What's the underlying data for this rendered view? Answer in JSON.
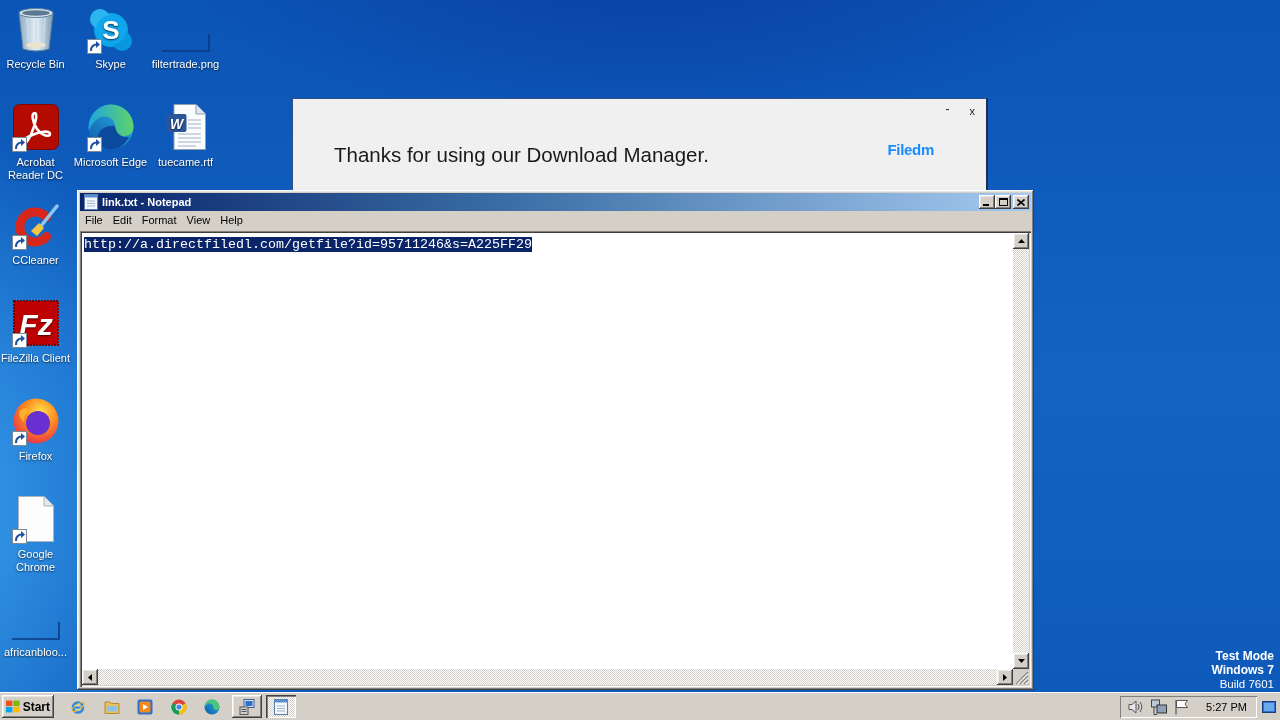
{
  "desktop": {
    "columns": [
      {
        "icons": [
          {
            "kind": "recycle-bin",
            "label": "Recycle Bin",
            "shortcut": false
          },
          {
            "kind": "pdf-reader",
            "label": "Acrobat Reader DC",
            "shortcut": true
          },
          {
            "kind": "ccleaner",
            "label": "CCleaner",
            "shortcut": true
          },
          {
            "kind": "filezilla",
            "glyph": "Fz",
            "label": "FileZilla Client",
            "shortcut": true
          },
          {
            "kind": "firefox",
            "label": "Firefox",
            "shortcut": true
          },
          {
            "kind": "blank-file",
            "label": "Google Chrome",
            "shortcut": true
          },
          {
            "kind": "thumbnail",
            "label": "africanbloo...",
            "shortcut": false
          }
        ]
      },
      {
        "icons": [
          {
            "kind": "skype",
            "glyph": "S",
            "label": "Skype",
            "shortcut": true
          },
          {
            "kind": "edge",
            "label": "Microsoft Edge",
            "shortcut": true
          }
        ]
      },
      {
        "icons": [
          {
            "kind": "thumbnail",
            "label": "filtertrade.png",
            "shortcut": false
          },
          {
            "kind": "word-doc",
            "glyph": "W",
            "label": "tuecame.rtf",
            "shortcut": false
          }
        ]
      }
    ],
    "system_notice": [
      {
        "text": "Test Mode",
        "bold": true
      },
      {
        "text": "Windows 7",
        "bold": true
      },
      {
        "text": "Build 7601",
        "bold": false
      }
    ]
  },
  "popup": {
    "buttons": [
      {
        "kind": "minimize",
        "label": "-"
      },
      {
        "kind": "close",
        "label": "x"
      }
    ],
    "message": "Thanks for using our Download Manager.",
    "logo": "Filedm"
  },
  "notepad": {
    "title": "link.txt - Notepad",
    "menu": [
      "File",
      "Edit",
      "Format",
      "View",
      "Help"
    ],
    "text": "http://a.directfiledl.com/getfile?id=95711246&s=A225FF29",
    "text_selected": true
  },
  "taskbar": {
    "start": "Start",
    "quick_launch": [
      {
        "kind": "ie"
      },
      {
        "kind": "explorer"
      },
      {
        "kind": "media-player"
      },
      {
        "kind": "chrome"
      },
      {
        "kind": "edge"
      }
    ],
    "tasks": [
      {
        "kind": "installer",
        "selected": false
      },
      {
        "kind": "notepad",
        "selected": true
      }
    ],
    "tray": [
      {
        "kind": "speaker"
      },
      {
        "kind": "network"
      },
      {
        "kind": "flag"
      }
    ],
    "clock": "5:27 PM"
  }
}
